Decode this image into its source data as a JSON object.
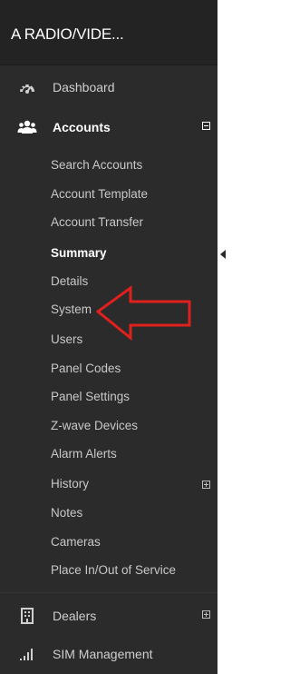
{
  "brand": {
    "title": "A RADIO/VIDE..."
  },
  "nav": {
    "dashboard": {
      "label": "Dashboard",
      "icon": "dashboard-gauge-icon"
    },
    "accounts": {
      "label": "Accounts",
      "icon": "users-group-icon",
      "expanded": true,
      "items": [
        {
          "label": "Search Accounts"
        },
        {
          "label": "Account Template"
        },
        {
          "label": "Account Transfer"
        },
        {
          "label": "Summary",
          "active": true
        },
        {
          "label": "Details"
        },
        {
          "label": "System"
        },
        {
          "label": "Users"
        },
        {
          "label": "Panel Codes"
        },
        {
          "label": "Panel Settings"
        },
        {
          "label": "Z-wave Devices"
        },
        {
          "label": "Alarm Alerts"
        },
        {
          "label": "History",
          "expandable": true
        },
        {
          "label": "Notes"
        },
        {
          "label": "Cameras"
        },
        {
          "label": "Place In/Out of Service"
        }
      ]
    },
    "dealers": {
      "label": "Dealers",
      "icon": "building-icon",
      "expandable": true
    },
    "sim": {
      "label": "SIM Management",
      "icon": "signal-bars-icon"
    }
  },
  "annotation": {
    "type": "red-outline-arrow",
    "color": "#e0201c",
    "points_to": "System"
  },
  "colors": {
    "sidebar_bg": "#2b2b2b",
    "brand_bg": "#232323",
    "text": "#c8c8c8",
    "active_text": "#ffffff"
  }
}
